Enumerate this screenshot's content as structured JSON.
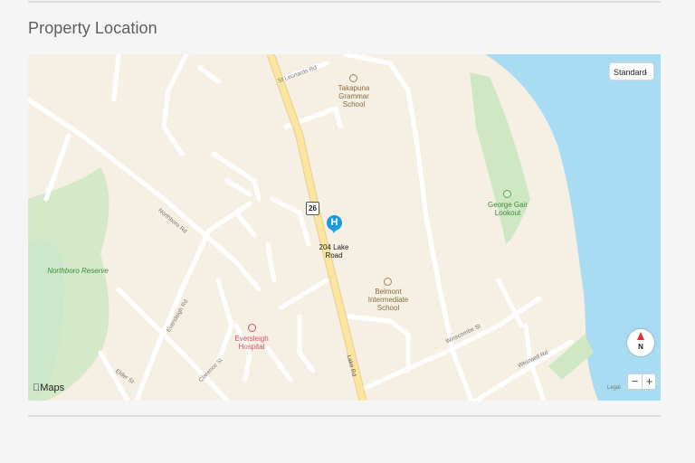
{
  "section": {
    "title": "Property Location"
  },
  "map": {
    "map_type_selected": "Standard",
    "marker": {
      "glyph": "H",
      "label_line1": "204 Lake",
      "label_line2": "Road"
    },
    "route_shield": "26",
    "pois": {
      "takapuna": [
        "Takapuna",
        "Grammar",
        "School"
      ],
      "george": [
        "George Gair",
        "Lookout"
      ],
      "belmont": [
        "Belmont",
        "Intermediate",
        "School"
      ],
      "eversleigh": [
        "Eversleigh",
        "Hospital"
      ],
      "northboro": "Northboro Reserve"
    },
    "streets": {
      "lake_rd": "Lake Rd",
      "northboro_rd": "Northboro Rd",
      "eversleigh_rd": "Eversleigh Rd",
      "winscombe_st": "Winscombe St",
      "westwell_rd": "Westwell Rd",
      "st_leonards_rd": "St Leonards Rd",
      "clarence_st": "Clarence St",
      "elder_st": "Elder St"
    },
    "compass_label": "N",
    "zoom_out": "−",
    "zoom_in": "+",
    "brand": "Maps",
    "legal": "Legal",
    "colors": {
      "land": "#f6efe4",
      "water": "#a8dcf2",
      "park": "#cfe8c4",
      "major_road": "#fbe5a0",
      "pin": "#1a9be0"
    }
  }
}
